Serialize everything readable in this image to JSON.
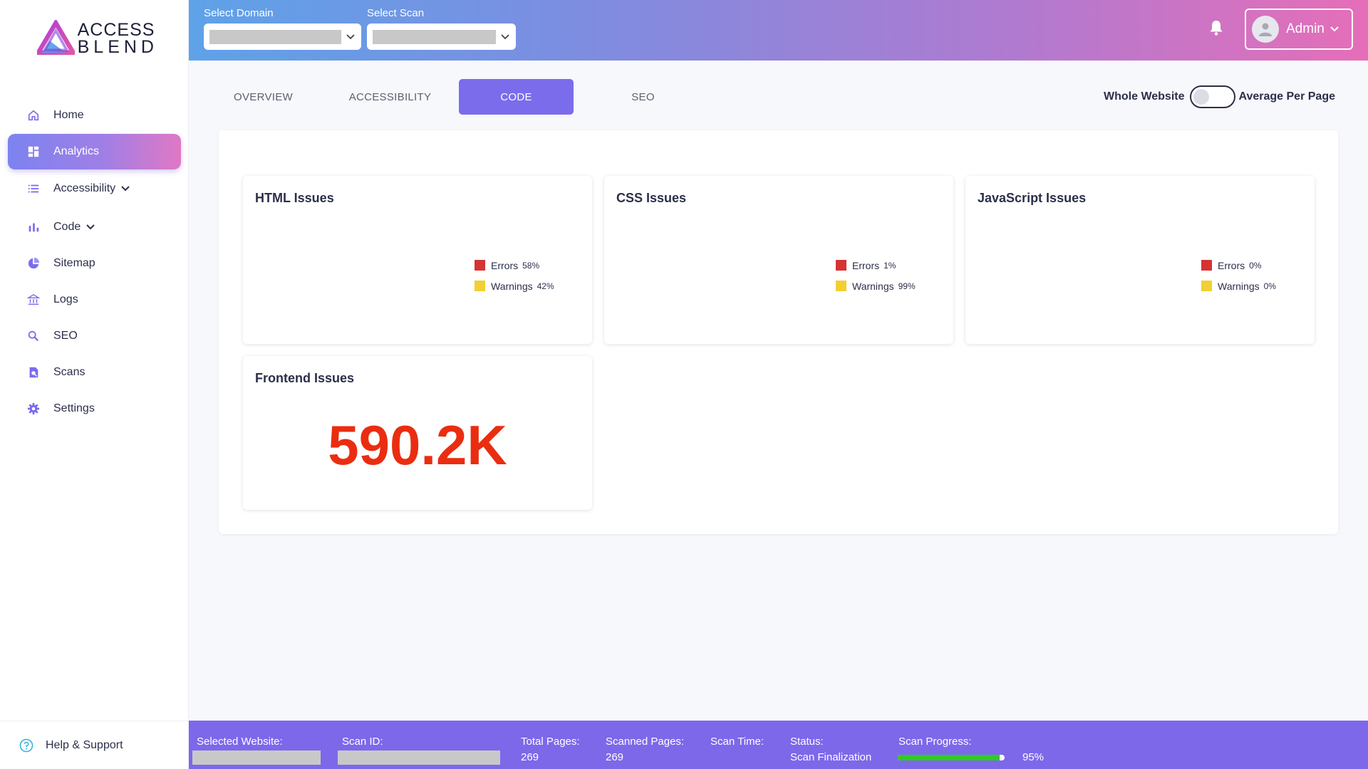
{
  "brand": {
    "line1": "ACCESS",
    "line2": "BLEND"
  },
  "sidebar": {
    "items": [
      {
        "label": "Home",
        "icon": "home-icon"
      },
      {
        "label": "Analytics",
        "icon": "dashboard-icon",
        "active": true
      },
      {
        "label": "Accessibility",
        "icon": "list-icon",
        "expandable": true
      },
      {
        "label": "Code",
        "icon": "bar-chart-icon",
        "expandable": true
      },
      {
        "label": "Sitemap",
        "icon": "pie-chart-icon"
      },
      {
        "label": "Logs",
        "icon": "bank-icon"
      },
      {
        "label": "SEO",
        "icon": "search-icon"
      },
      {
        "label": "Scans",
        "icon": "document-search-icon"
      },
      {
        "label": "Settings",
        "icon": "gear-icon"
      }
    ],
    "help_label": "Help & Support"
  },
  "topbar": {
    "domain_label": "Select Domain",
    "scan_label": "Select Scan",
    "user_name": "Admin"
  },
  "tabs": [
    {
      "label": "OVERVIEW"
    },
    {
      "label": "ACCESSIBILITY"
    },
    {
      "label": "CODE",
      "active": true
    },
    {
      "label": "SEO"
    }
  ],
  "view_toggle": {
    "left_label": "Whole Website",
    "right_label": "Average Per Page",
    "on": false
  },
  "cards": {
    "html": {
      "title": "HTML Issues",
      "errors_label": "Errors",
      "errors_pct": "58%",
      "warnings_label": "Warnings",
      "warnings_pct": "42%"
    },
    "css": {
      "title": "CSS Issues",
      "errors_label": "Errors",
      "errors_pct": "1%",
      "warnings_label": "Warnings",
      "warnings_pct": "99%"
    },
    "js": {
      "title": "JavaScript Issues",
      "errors_label": "Errors",
      "errors_pct": "0%",
      "warnings_label": "Warnings",
      "warnings_pct": "0%"
    },
    "frontend": {
      "title": "Frontend Issues",
      "value": "590.2K"
    }
  },
  "footer": {
    "selected_website_label": "Selected Website:",
    "scan_id_label": "Scan ID:",
    "total_pages_label": "Total Pages:",
    "total_pages": "269",
    "scanned_pages_label": "Scanned Pages:",
    "scanned_pages": "269",
    "scan_time_label": "Scan Time:",
    "status_label": "Status:",
    "status": "Scan Finalization",
    "scan_progress_label": "Scan Progress:",
    "scan_progress": "95%",
    "scan_progress_fraction": 0.95
  },
  "colors": {
    "accent": "#7b6cec",
    "errors": "#d63333",
    "warnings": "#f2d033",
    "big_number": "#ea2d10",
    "progress": "#2ecc1f"
  }
}
